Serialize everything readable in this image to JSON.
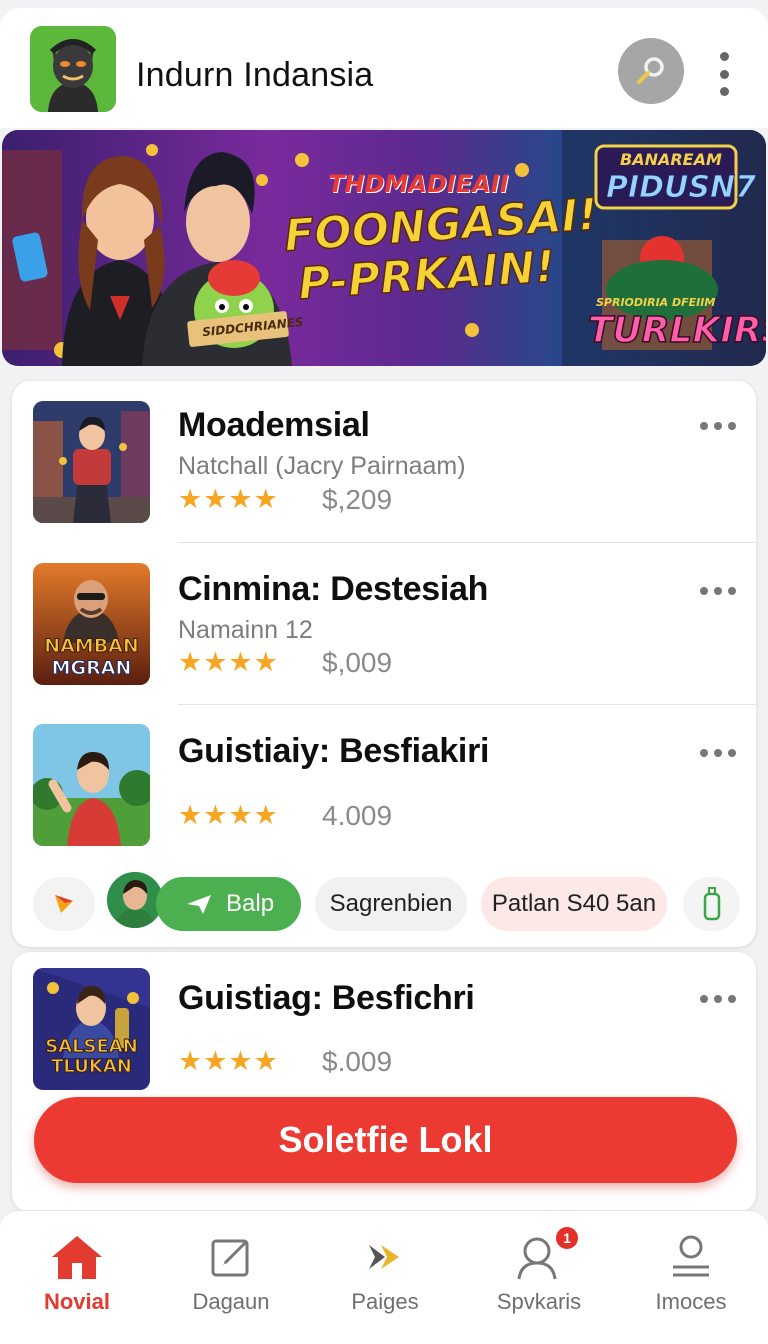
{
  "header": {
    "title": "Indurn Indansia",
    "logo_icon": "app-logo-icon",
    "search_icon": "search-icon",
    "menu_icon": "more-vertical-icon"
  },
  "banner": {
    "headline_small": "THDMADIEAII",
    "headline_line1": "FOONGASAI!",
    "headline_line2": "P-PRKAIN!",
    "ribbon": "SIDDCHRIANES",
    "corner_top": "BANAREAM",
    "corner_main": "PIDUSN7",
    "corner_sub": "SPRIODIRIA DFEIIM",
    "corner_brand": "TURLKIRS"
  },
  "games": [
    {
      "title": "Moademsial",
      "subtitle": "Natchall (Jacry Pairnaam)",
      "stars": "★★★★",
      "price": "$,209"
    },
    {
      "title": "Cinmina: Destesiah",
      "subtitle": "Namainn 12",
      "stars": "★★★★",
      "price": "$,009",
      "thumb_text_1": "NAMBAN",
      "thumb_text_2": "MGRAN"
    },
    {
      "title": "Guistiaiy: Besfiakiri",
      "subtitle": "",
      "stars": "★★★★",
      "price": "4.009"
    },
    {
      "title": "Guistiag: Besfichri",
      "subtitle": "",
      "stars": "★★★★",
      "price": "$.009",
      "thumb_text_1": "SALSEAN",
      "thumb_text_2": "TLUKAN"
    }
  ],
  "chips": {
    "play_icon": "play-icon",
    "avatar_icon": "avatar-icon",
    "green_label": "Balp",
    "gray_label": "Sagrenbien",
    "pink_label": "Patlan S40 5an",
    "bottle_icon": "bottle-icon"
  },
  "cta": {
    "label": "Soletfie Lokl"
  },
  "nav": {
    "items": [
      {
        "label": "Novial",
        "icon": "home-icon",
        "active": true
      },
      {
        "label": "Dagaun",
        "icon": "edit-icon",
        "active": false
      },
      {
        "label": "Paiges",
        "icon": "forward-icon",
        "active": false
      },
      {
        "label": "Spvkaris",
        "icon": "user-icon",
        "active": false,
        "badge": "1"
      },
      {
        "label": "Imoces",
        "icon": "profile-icon",
        "active": false
      }
    ]
  },
  "colors": {
    "accent": "#ec3a33",
    "star": "#f6a623",
    "green": "#4caf50",
    "pink_chip": "#fde8e8"
  }
}
